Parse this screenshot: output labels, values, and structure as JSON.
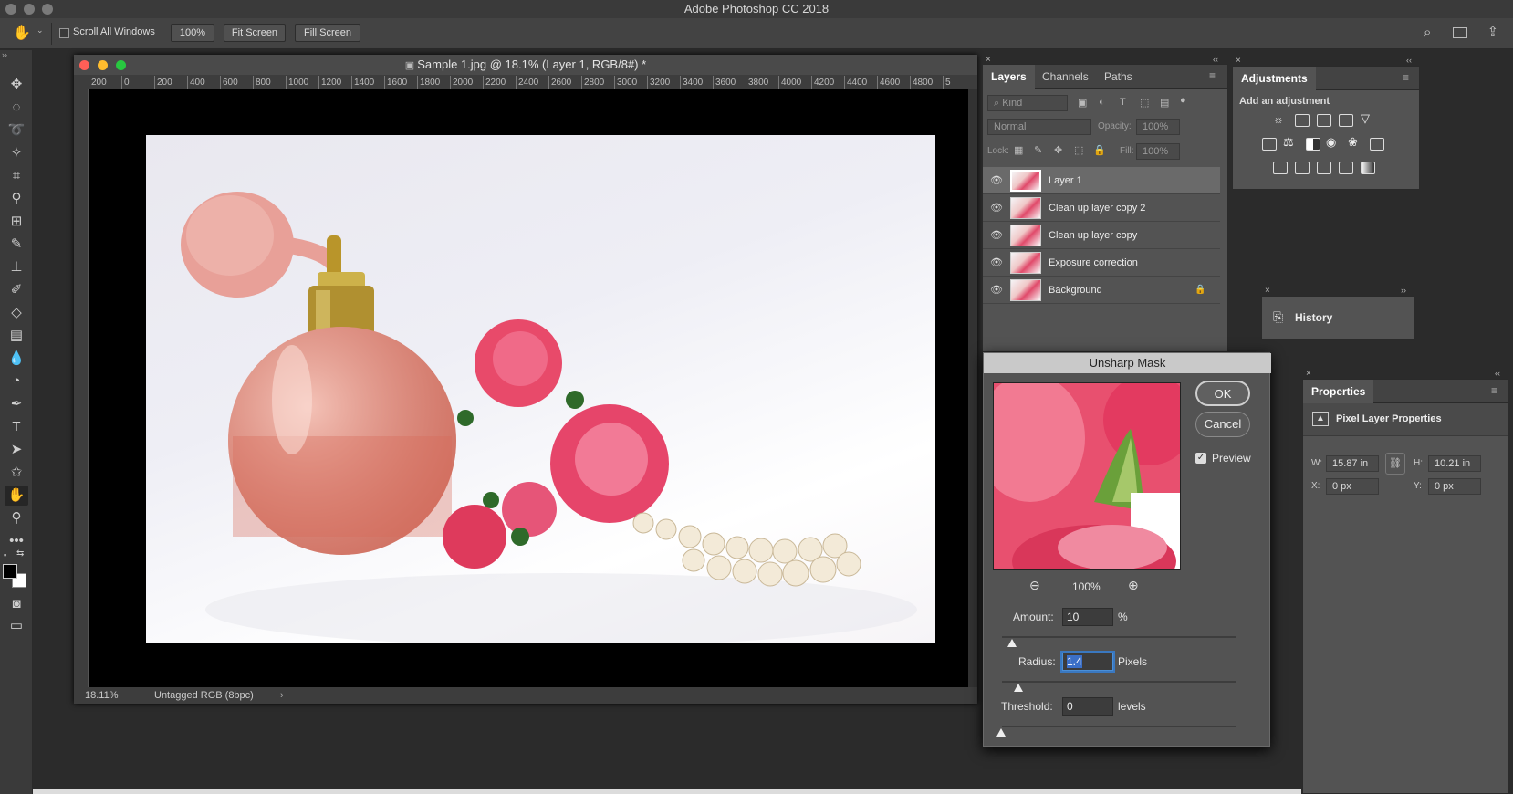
{
  "app": {
    "title": "Adobe Photoshop CC 2018"
  },
  "options": {
    "scroll_all_windows": "Scroll All Windows",
    "zoom": "100%",
    "fit_screen": "Fit Screen",
    "fill_screen": "Fill Screen"
  },
  "document": {
    "title": "Sample 1.jpg @ 18.1% (Layer 1, RGB/8#) *",
    "ruler_ticks": [
      "200",
      "0",
      "200",
      "400",
      "600",
      "800",
      "1000",
      "1200",
      "1400",
      "1600",
      "1800",
      "2000",
      "2200",
      "2400",
      "2600",
      "2800",
      "3000",
      "3200",
      "3400",
      "3600",
      "3800",
      "4000",
      "4200",
      "4400",
      "4600",
      "4800",
      "5"
    ],
    "status_zoom": "18.11%",
    "status_profile": "Untagged RGB (8bpc)"
  },
  "layers_panel": {
    "tabs": [
      "Layers",
      "Channels",
      "Paths"
    ],
    "kind_placeholder": "Kind",
    "blend_mode": "Normal",
    "opacity_label": "Opacity:",
    "opacity_value": "100%",
    "lock_label": "Lock:",
    "fill_label": "Fill:",
    "fill_value": "100%",
    "layers": [
      {
        "name": "Layer 1"
      },
      {
        "name": "Clean up layer copy 2"
      },
      {
        "name": "Clean up layer copy"
      },
      {
        "name": "Exposure correction"
      },
      {
        "name": "Background"
      }
    ]
  },
  "adjustments_panel": {
    "tab": "Adjustments",
    "subtitle": "Add an adjustment"
  },
  "history_panel": {
    "tab": "History"
  },
  "properties_panel": {
    "tab": "Properties",
    "header": "Pixel Layer Properties",
    "w_label": "W:",
    "w_value": "15.87 in",
    "h_label": "H:",
    "h_value": "10.21 in",
    "x_label": "X:",
    "x_value": "0 px",
    "y_label": "Y:",
    "y_value": "0 px"
  },
  "unsharp_mask": {
    "title": "Unsharp Mask",
    "ok": "OK",
    "cancel": "Cancel",
    "preview": "Preview",
    "preview_zoom": "100%",
    "amount_label": "Amount:",
    "amount_value": "10",
    "amount_unit": "%",
    "radius_label": "Radius:",
    "radius_value": "1.4",
    "radius_unit": "Pixels",
    "threshold_label": "Threshold:",
    "threshold_value": "0",
    "threshold_unit": "levels"
  }
}
